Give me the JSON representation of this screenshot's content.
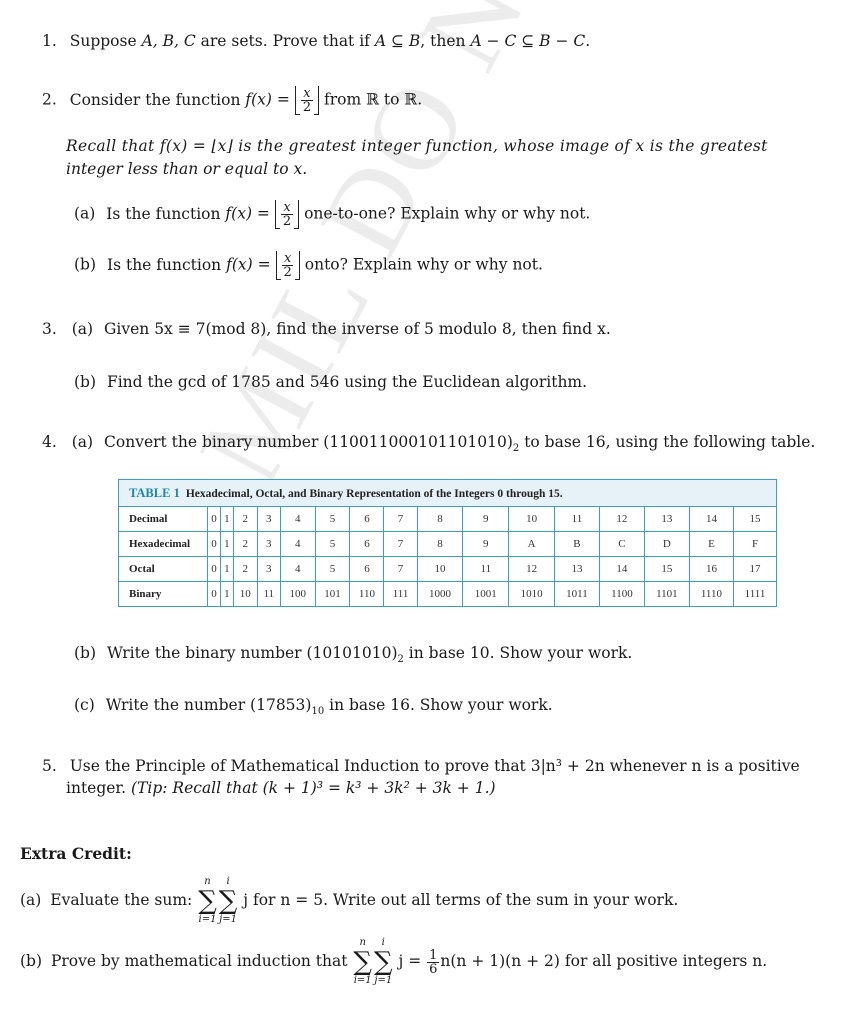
{
  "watermark": "AMIL DO NOT DUPLICATE",
  "problems": {
    "p1": {
      "num": "1.",
      "text_before": "Suppose ",
      "sets": "A, B, C",
      "text_mid": " are sets. Prove that if ",
      "cond": "A ⊆ B",
      "text_then": ", then ",
      "concl": "A − C ⊆ B − C",
      "end": "."
    },
    "p2": {
      "num": "2.",
      "intro_before": "Consider the function ",
      "fx": "f(x) =",
      "frac_num": "x",
      "frac_den": "2",
      "intro_after": " from ℝ to ℝ.",
      "recall_line1": "Recall that f(x) = ⌊x⌋ is the greatest integer function, whose image of x is the greatest",
      "recall_line2": "integer less than or equal to x.",
      "a": {
        "label": "(a)",
        "before": "Is the function ",
        "after": " one-to-one? Explain why or why not."
      },
      "b": {
        "label": "(b)",
        "before": "Is the function ",
        "after": " onto? Explain why or why not."
      }
    },
    "p3": {
      "num": "3.",
      "a": {
        "label": "(a)",
        "text": "Given 5x ≡ 7(mod 8), find the inverse of 5 modulo 8, then find x."
      },
      "b": {
        "label": "(b)",
        "text": "Find the gcd of 1785 and 546 using the Euclidean algorithm."
      }
    },
    "p4": {
      "num": "4.",
      "a": {
        "label": "(a)",
        "before": "Convert the binary number (110011000101101010)",
        "sub": "2",
        "after": " to base 16, using the following table."
      },
      "b": {
        "label": "(b)",
        "before": "Write the binary number (10101010)",
        "sub": "2",
        "after": " in base 10. Show your work."
      },
      "c": {
        "label": "(c)",
        "before": "Write the number (17853)",
        "sub": "10",
        "after": " in base 16. Show your work."
      }
    },
    "p5": {
      "num": "5.",
      "line1": "Use the Principle of Mathematical Induction to prove that 3|n³ + 2n whenever n is a positive",
      "line2_plain": "integer. ",
      "line2_tip": "(Tip: Recall that (k + 1)³ = k³ + 3k² + 3k + 1.)"
    }
  },
  "table": {
    "tag": "TABLE 1",
    "title": "Hexadecimal, Octal, and Binary Representation of the Integers 0 through 15.",
    "rows": [
      {
        "header": "Decimal",
        "cells": [
          "0",
          "1",
          "2",
          "3",
          "4",
          "5",
          "6",
          "7",
          "8",
          "9",
          "10",
          "11",
          "12",
          "13",
          "14",
          "15"
        ]
      },
      {
        "header": "Hexadecimal",
        "cells": [
          "0",
          "1",
          "2",
          "3",
          "4",
          "5",
          "6",
          "7",
          "8",
          "9",
          "A",
          "B",
          "C",
          "D",
          "E",
          "F"
        ]
      },
      {
        "header": "Octal",
        "cells": [
          "0",
          "1",
          "2",
          "3",
          "4",
          "5",
          "6",
          "7",
          "10",
          "11",
          "12",
          "13",
          "14",
          "15",
          "16",
          "17"
        ]
      },
      {
        "header": "Binary",
        "cells": [
          "0",
          "1",
          "10",
          "11",
          "100",
          "101",
          "110",
          "111",
          "1000",
          "1001",
          "1010",
          "1011",
          "1100",
          "1101",
          "1110",
          "1111"
        ]
      }
    ]
  },
  "extra_credit": {
    "title": "Extra Credit:",
    "a": {
      "label": "(a)",
      "before": "Evaluate the sum: ",
      "sum_outer_top": "n",
      "sum_outer_bot": "i=1",
      "sum_inner_top": "i",
      "sum_inner_bot": "j=1",
      "after": " j for n = 5. Write out all terms of the sum in your work."
    },
    "b": {
      "label": "(b)",
      "before": "Prove by mathematical induction that ",
      "sum_outer_top": "n",
      "sum_outer_bot": "i=1",
      "sum_inner_top": "i",
      "sum_inner_bot": "j=1",
      "eq": " j = ",
      "frac_num": "1",
      "frac_den": "6",
      "after": "n(n + 1)(n + 2) for all positive integers n."
    }
  }
}
